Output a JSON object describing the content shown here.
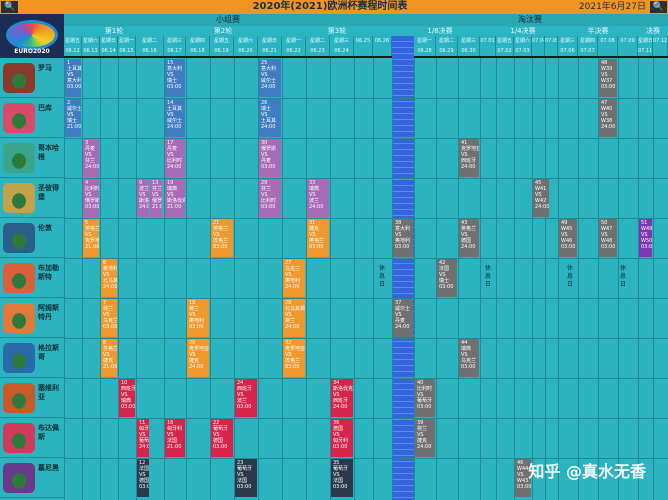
{
  "corners": {
    "left": "🔍",
    "right": "🔍"
  },
  "title": "2020年(2021)欧洲杯赛程时间表",
  "date": "2021年6月27日",
  "stages": {
    "group": "小组赛",
    "knockout": "淘汰赛"
  },
  "rounds": [
    "第1轮",
    "第2轮",
    "第3轮",
    "1/8决赛",
    "1/4决赛",
    "半决赛",
    "决赛"
  ],
  "logo": "EURO2020",
  "dates": [
    {
      "d": "星期五",
      "n": "06.12"
    },
    {
      "d": "星期六",
      "n": "06.13"
    },
    {
      "d": "星期日",
      "n": "06.14"
    },
    {
      "d": "星期一",
      "n": "06.15"
    },
    {
      "d": "星期二",
      "n": "06.16"
    },
    {
      "d": "星期三",
      "n": "06.17"
    },
    {
      "d": "星期四",
      "n": "06.18"
    },
    {
      "d": "星期五",
      "n": "06.19"
    },
    {
      "d": "星期六",
      "n": "06.20"
    },
    {
      "d": "星期日",
      "n": "06.21"
    },
    {
      "d": "星期一",
      "n": "06.22"
    },
    {
      "d": "星期二",
      "n": "06.23"
    },
    {
      "d": "星期三",
      "n": "06.24"
    },
    {
      "d": "",
      "n": "06.25"
    },
    {
      "d": "",
      "n": "06.26"
    },
    {
      "d": "星期日",
      "n": "06.27"
    },
    {
      "d": "星期一",
      "n": "06.28"
    },
    {
      "d": "星期二",
      "n": "06.29"
    },
    {
      "d": "星期三",
      "n": "06.30"
    },
    {
      "d": "",
      "n": "07.01"
    },
    {
      "d": "星期五",
      "n": "07.02"
    },
    {
      "d": "星期六",
      "n": "07.03"
    },
    {
      "d": "",
      "n": "07.04"
    },
    {
      "d": "",
      "n": "07.05"
    },
    {
      "d": "星期三",
      "n": "07.06"
    },
    {
      "d": "星期四",
      "n": "07.07"
    },
    {
      "d": "",
      "n": "07.08"
    },
    {
      "d": "",
      "n": "07.09"
    },
    {
      "d": "星期日",
      "n": "07.11"
    },
    {
      "d": "",
      "n": "07.12"
    }
  ],
  "venues": [
    "罗马",
    "巴库",
    "哥本哈根",
    "圣彼得堡",
    "伦敦",
    "布加勒斯特",
    "阿姆斯特丹",
    "格拉斯哥",
    "塞维利亚",
    "布达佩斯",
    "慕尼黑"
  ],
  "rest_label": "休息日",
  "matches": [
    {
      "t": "1|土耳其|VS|意大利|03:00"
    },
    {
      "t": "15|意大利|VS|瑞士|03:00"
    },
    {
      "t": "25|意大利|VS|威尔士|24:00"
    },
    {
      "t": "48|W39|VS|W37|03:00"
    },
    {
      "t": "2|威尔士|VS|瑞士|21:00"
    },
    {
      "t": "14|土耳其|VS|威尔士|24:00"
    },
    {
      "t": "26|瑞士|VS|土耳其|24:00"
    },
    {
      "t": "47|W40|VS|W38|24:00"
    },
    {
      "t": "3|丹麦|VS|芬兰|24:00"
    },
    {
      "t": "17|丹麦|VS|比利时|24:00"
    },
    {
      "t": "30|俄罗斯|VS|丹麦|03:00"
    },
    {
      "t": "41|克罗地亚|VS|西班牙|24:00"
    },
    {
      "t": "4|比利时|VS|俄罗斯|03:00"
    },
    {
      "t": "9|波兰|VS|斯洛伐克|24:00"
    },
    {
      "t": "13|芬兰|VS|俄罗斯|21:00"
    },
    {
      "t": "19|瑞典|VS|斯洛伐克|21:00"
    },
    {
      "t": "29|芬兰|VS|比利时|03:00"
    },
    {
      "t": "33|瑞典|VS|波兰|24:00"
    },
    {
      "t": "45|W41|VS|W42|24:00"
    },
    {
      "t": "5|英格兰|VS|克罗地亚|21:00"
    },
    {
      "t": "21|英格兰|VS|苏格兰|03:00"
    },
    {
      "t": "31|捷克|VS|英格兰|03:00"
    },
    {
      "t": "38|意大利|VS|奥地利|03:00"
    },
    {
      "t": "43|英格兰|VS|德国|24:00"
    },
    {
      "t": "49|W45|VS|W46|03:00"
    },
    {
      "t": "50|W47|VS|W48|03:00"
    },
    {
      "t": "51|W49|VS|W50|03:00"
    },
    {
      "t": "6|奥地利|VS|北马其顿|24:00"
    },
    {
      "t": "27|乌克兰|VS|奥地利|24:00"
    },
    {
      "t": "42|法国|VS|瑞士|03:00"
    },
    {
      "t": "7|荷兰|VS|乌克兰|03:00"
    },
    {
      "t": "18|荷兰|VS|奥地利|03:00"
    },
    {
      "t": "28|北马其顿|VS|荷兰|24:00"
    },
    {
      "t": "37|威尔士|VS|丹麦|24:00"
    },
    {
      "t": "8|苏格兰|VS|捷克|21:00"
    },
    {
      "t": "20|克罗地亚|VS|捷克|24:00"
    },
    {
      "t": "32|克罗地亚|VS|苏格兰|03:00"
    },
    {
      "t": "44|瑞典|VS|乌克兰|03:00"
    },
    {
      "t": "10|西班牙|VS|瑞典|03:00"
    },
    {
      "t": "24|西班牙|VS|波兰|03:00"
    },
    {
      "t": "34|斯洛伐克|VS|西班牙|24:00"
    },
    {
      "t": "40|比利时|VS|葡萄牙|03:00"
    },
    {
      "t": "11|匈牙利|VS|葡萄牙|24:00"
    },
    {
      "t": "16|匈牙利|VS|法国|21:00"
    },
    {
      "t": "22|葡萄牙|VS|德国|03:00"
    },
    {
      "t": "36|德国|VS|匈牙利|03:00"
    },
    {
      "t": "39|荷兰|VS|捷克|24:00"
    },
    {
      "t": "12|法国|VS|德国|03:00"
    },
    {
      "t": "23|葡萄牙|VS|法国|03:00"
    },
    {
      "t": "35|葡萄牙|VS|法国|03:00"
    },
    {
      "t": "46|W44|VS|W43|03:00"
    }
  ],
  "watermark": "知乎 @真水无香"
}
